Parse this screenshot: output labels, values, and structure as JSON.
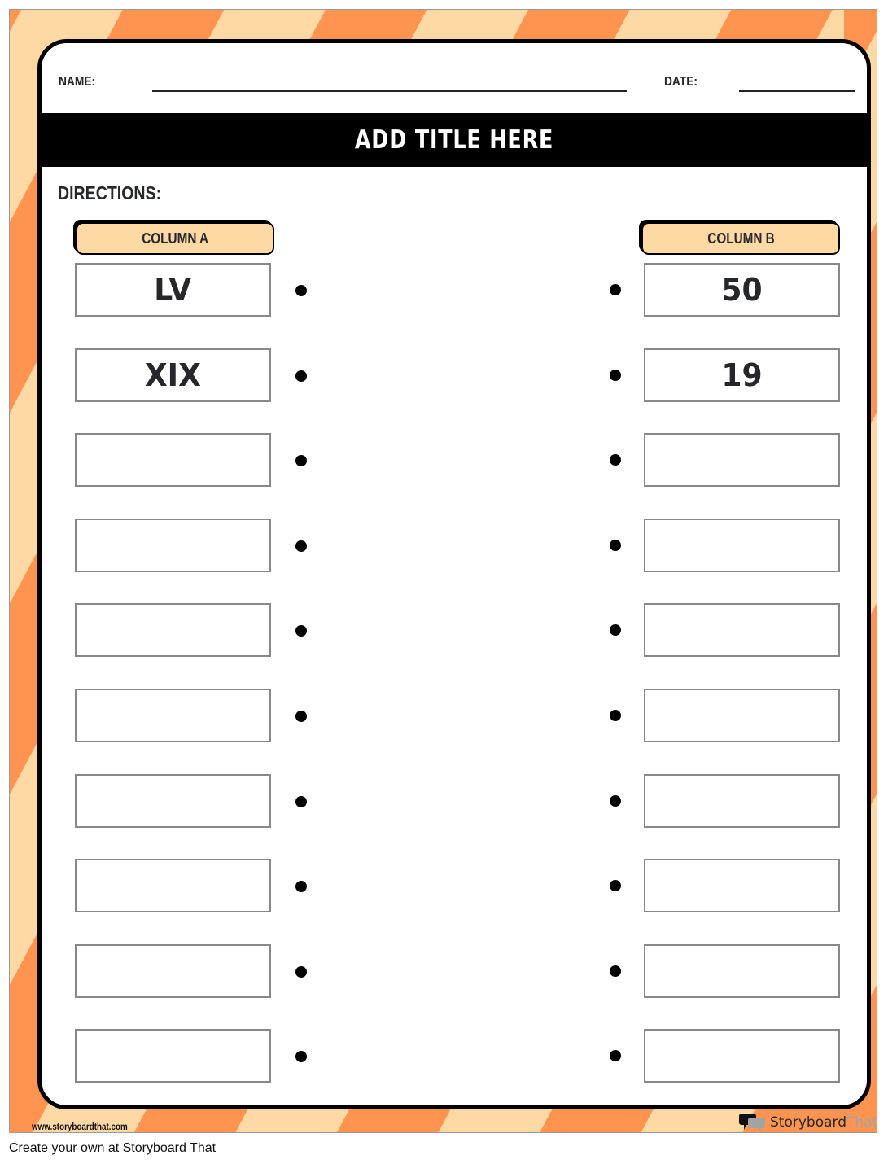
{
  "worksheet": {
    "name_label": "NAME:",
    "date_label": "DATE:",
    "title": "ADD TITLE HERE",
    "directions_label": "DIRECTIONS:",
    "column_a_header": "COLUMN A",
    "column_b_header": "COLUMN B",
    "column_a_items": [
      "LV",
      "XIX",
      "",
      "",
      "",
      "",
      "",
      "",
      "",
      ""
    ],
    "column_b_items": [
      "50",
      "19",
      "",
      "",
      "",
      "",
      "",
      "",
      "",
      ""
    ]
  },
  "footer": {
    "url": "www.storyboardthat.com",
    "brand_part1": "Storyboard",
    "brand_part2": "That",
    "brand_icon": "speech-bubbles-icon"
  },
  "caption": "Create your own at Storyboard That",
  "colors": {
    "stripe_orange": "#fe9450",
    "stripe_peach": "#fed9a4",
    "header_fill": "#fed9a4",
    "title_band": "#000000"
  }
}
